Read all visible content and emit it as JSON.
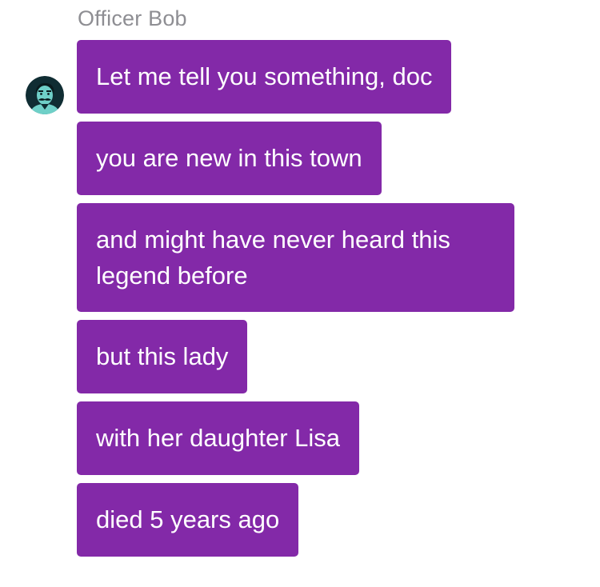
{
  "chat": {
    "sender": "Officer Bob",
    "accent_color": "#8329a8",
    "avatar_icon": "officer-avatar-icon",
    "messages": [
      {
        "text": "Let me tell you something, doc"
      },
      {
        "text": "you are new in this town"
      },
      {
        "text": "and might have never heard this legend before"
      },
      {
        "text": "but this lady"
      },
      {
        "text": "with her daughter Lisa"
      },
      {
        "text": "died 5 years ago"
      }
    ]
  }
}
